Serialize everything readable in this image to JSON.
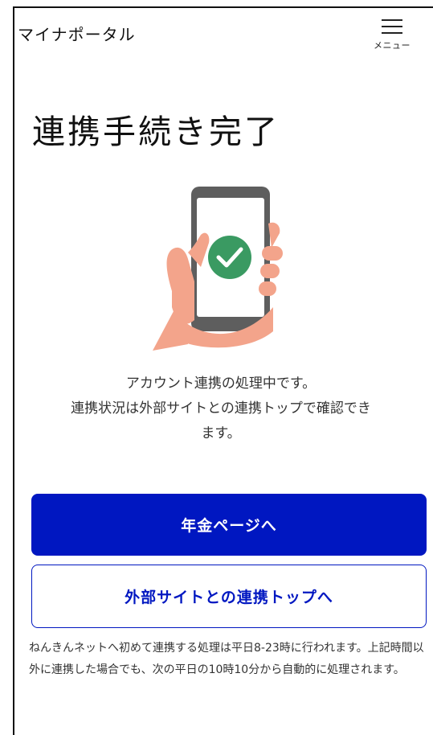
{
  "header": {
    "brand": "マイナポータル",
    "menu_label": "メニュー"
  },
  "main": {
    "title": "連携手続き完了",
    "message_line1": "アカウント連携の処理中です。",
    "message_line2": "連携状況は外部サイトとの連携トップで確認でき",
    "message_line3": "ます。"
  },
  "buttons": {
    "primary_label": "年金ページへ",
    "secondary_label": "外部サイトとの連携トップへ"
  },
  "notice": {
    "text": "ねんきんネットへ初めて連携する処理は平日8-23時に行われます。上記時間以外に連携した場合でも、次の平日の10時10分から自動的に処理されます。"
  },
  "colors": {
    "primary": "#0017C1",
    "success": "#3A9A62",
    "skin": "#F3A48B",
    "phone": "#5E5E5E"
  },
  "icons": {
    "menu": "hamburger-icon",
    "illustration": "phone-check-illustration"
  }
}
